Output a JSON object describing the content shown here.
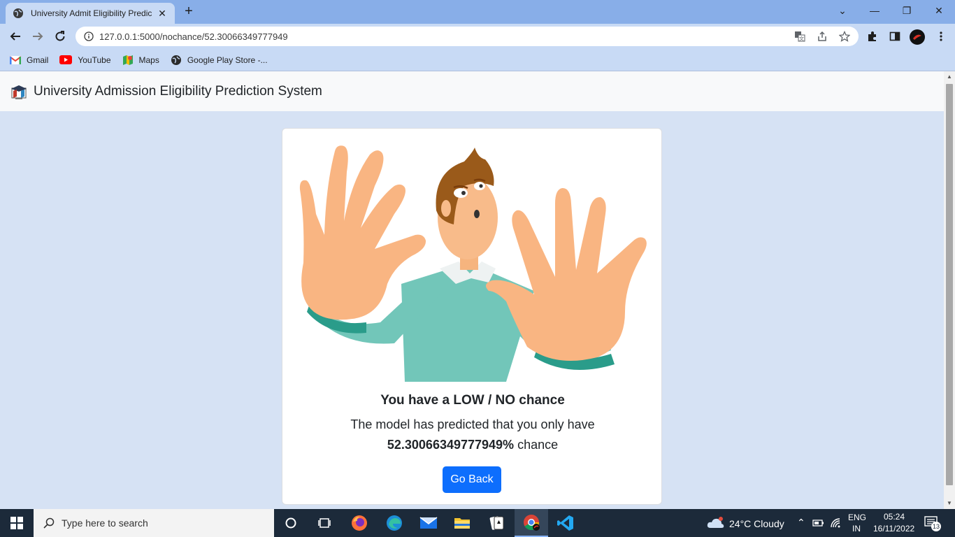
{
  "browser": {
    "tab_title": "University Admit Eligibility Predic",
    "tab_close": "✕",
    "new_tab": "+",
    "url": "127.0.0.1:5000/nochance/52.30066349777949",
    "window_controls": [
      "⌄",
      "—",
      "❐",
      "✕"
    ]
  },
  "bookmarks": [
    {
      "label": "Gmail",
      "icon": "gmail-icon"
    },
    {
      "label": "YouTube",
      "icon": "youtube-icon"
    },
    {
      "label": "Maps",
      "icon": "maps-icon"
    },
    {
      "label": "Google Play Store -...",
      "icon": "globe-icon"
    }
  ],
  "app": {
    "brand": "University Admission Eligibility Prediction System"
  },
  "result": {
    "title": "You have a LOW / NO chance",
    "line1": "The model has predicted that you only have",
    "percent": "52.30066349777949%",
    "suffix": " chance",
    "button": "Go Back"
  },
  "taskbar": {
    "search_placeholder": "Type here to search",
    "weather": "24°C  Cloudy",
    "lang_top": "ENG",
    "lang_bottom": "IN",
    "time": "05:24",
    "date": "16/11/2022",
    "notification_count": "13"
  },
  "colors": {
    "primary_button": "#0d6efd",
    "tab_strip": "#88aee8",
    "toolbar": "#c8daf5",
    "page_bg": "#d6e2f4",
    "taskbar": "#1c2a3a"
  }
}
